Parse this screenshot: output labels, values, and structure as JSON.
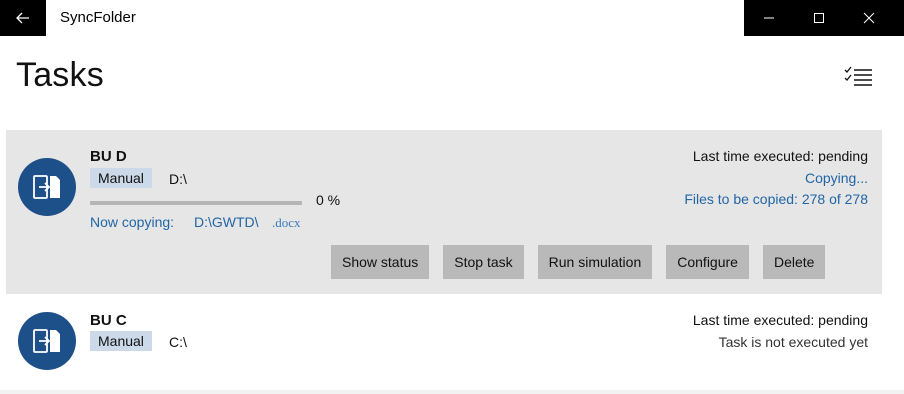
{
  "window": {
    "title": "SyncFolder",
    "back_icon": "arrow-left-icon",
    "controls": [
      "minimize-icon",
      "maximize-icon",
      "close-icon"
    ]
  },
  "page": {
    "title": "Tasks",
    "multiselect_icon": "checklist-icon"
  },
  "tasks": [
    {
      "name": "BU D",
      "mode": "Manual",
      "path": "D:\\",
      "progress_percent": 0,
      "progress_text": "0 %",
      "now_copying_label": "Now copying:",
      "now_copying_file": "D:\\GWTD\\",
      "now_copying_ext": ".docx",
      "last_executed": "Last time executed: pending",
      "status": "Copying...",
      "files_status": "Files to be copied: 278 of 278",
      "actions": [
        "Show status",
        "Stop task",
        "Run simulation",
        "Configure",
        "Delete"
      ],
      "icon": "sync-folder-icon"
    },
    {
      "name": "BU C",
      "mode": "Manual",
      "path": "C:\\",
      "last_executed": "Last time executed: pending",
      "status": "Task is not executed yet",
      "icon": "sync-folder-icon"
    }
  ],
  "colors": {
    "accent": "#1d5088",
    "link": "#2166a6",
    "active_card_bg": "#e6e6e6",
    "button_bg": "#b9b9b9",
    "badge_bg": "#cbd9e8"
  }
}
